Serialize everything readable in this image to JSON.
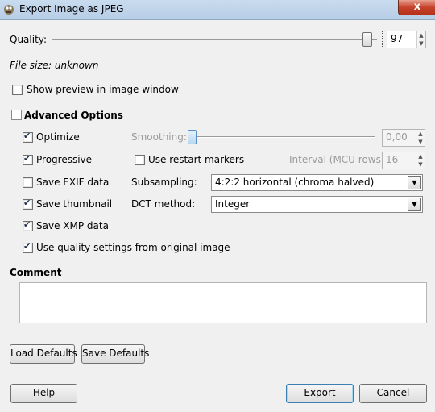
{
  "window": {
    "title": "Export Image as JPEG",
    "close_label": "x"
  },
  "quality": {
    "label": "Quality:",
    "value": "97",
    "slider_level": 97
  },
  "file_size": "File size: unknown",
  "show_preview": {
    "label": "Show preview in image window",
    "checked": false
  },
  "advanced": {
    "toggle": "⊟",
    "heading": "Advanced Options",
    "optimize": {
      "label": "Optimize",
      "checked": true
    },
    "progressive": {
      "label": "Progressive",
      "checked": true
    },
    "save_exif": {
      "label": "Save EXIF data",
      "checked": false
    },
    "save_thumbnail": {
      "label": "Save thumbnail",
      "checked": true
    },
    "save_xmp": {
      "label": "Save XMP data",
      "checked": true
    },
    "use_quality": {
      "label": "Use quality settings from original image",
      "checked": true
    },
    "smoothing": {
      "label": "Smoothing:",
      "value": "0,00",
      "slider_level": 0
    },
    "restart_markers": {
      "label": "Use restart markers",
      "checked": false
    },
    "interval": {
      "label": "Interval (MCU rows):",
      "value": "16"
    },
    "subsampling": {
      "label": "Subsampling:",
      "value": "4:2:2 horizontal (chroma halved)"
    },
    "dct": {
      "label": "DCT method:",
      "value": "Integer"
    }
  },
  "comment": {
    "label": "Comment",
    "value": ""
  },
  "buttons": {
    "load_defaults": "Load Defaults",
    "save_defaults": "Save Defaults",
    "help": "Help",
    "export": "Export",
    "cancel": "Cancel"
  },
  "icons": {
    "app": "gimp-icon",
    "close": "close-icon",
    "dropdown": "dropdown-arrow-icon",
    "collapse": "collapse-minus-icon"
  }
}
